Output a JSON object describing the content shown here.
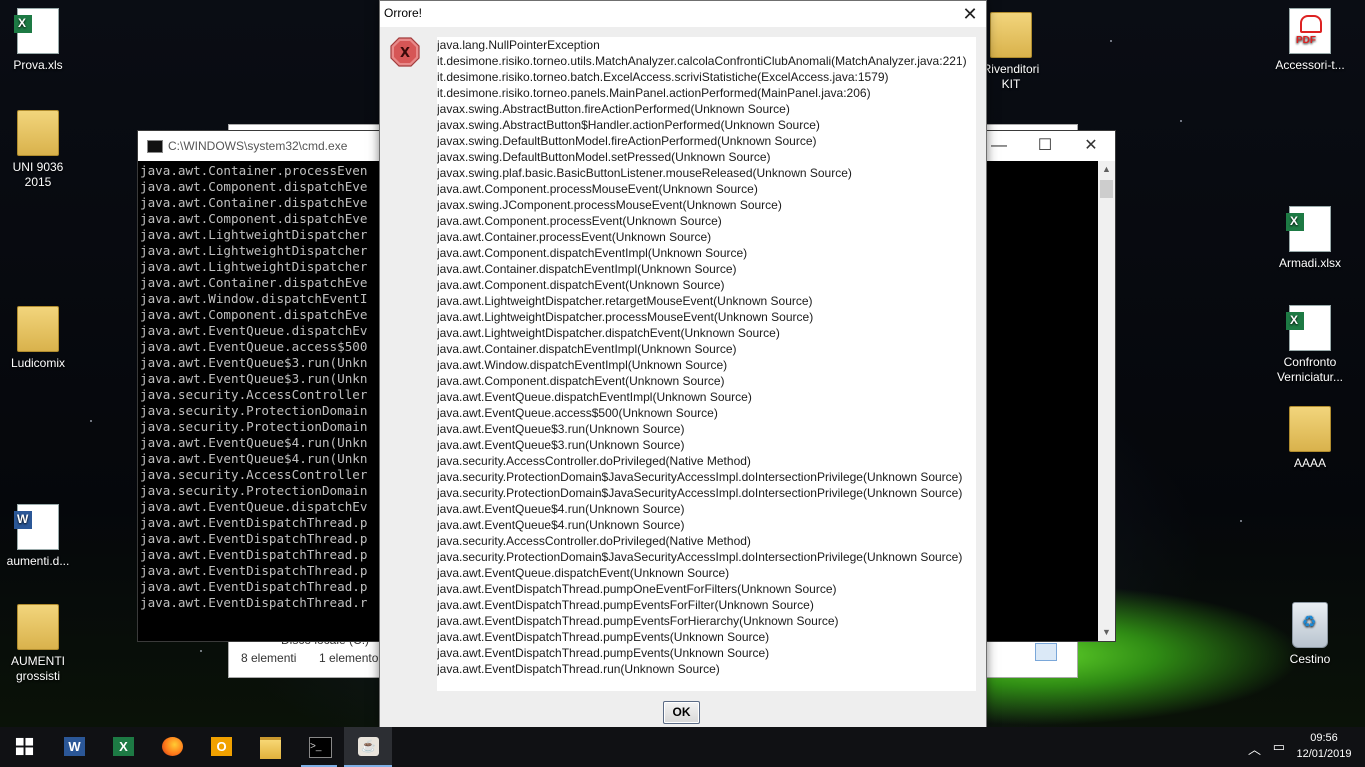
{
  "desktop": {
    "icons_left": [
      {
        "label": "Prova.xls",
        "type": "excel"
      },
      {
        "label": "UNI 9036\n2015",
        "type": "folder"
      },
      {
        "label": "Ludicomix",
        "type": "folder"
      },
      {
        "label": "aumenti.d...",
        "type": "word"
      },
      {
        "label": "AUMENTI\ngrossisti",
        "type": "folder"
      }
    ],
    "icons_right": [
      {
        "label": "Rivenditori\nKIT",
        "type": "folder"
      },
      {
        "label": "Accessori-t...",
        "type": "pdf"
      },
      {
        "label": "Armadi.xlsx",
        "type": "excel"
      },
      {
        "label": "Confronto\nVerniciatur...",
        "type": "excel"
      },
      {
        "label": "AAAA",
        "type": "folder"
      },
      {
        "label": "Cestino",
        "type": "recycle-bin"
      }
    ]
  },
  "cmd_window": {
    "title": "C:\\WINDOWS\\system32\\cmd.exe",
    "lines": [
      "java.awt.Container.processEven",
      "java.awt.Component.dispatchEve",
      "java.awt.Container.dispatchEve",
      "java.awt.Component.dispatchEve",
      "java.awt.LightweightDispatcher",
      "java.awt.LightweightDispatcher",
      "java.awt.LightweightDispatcher",
      "java.awt.Container.dispatchEve",
      "java.awt.Window.dispatchEventI",
      "java.awt.Component.dispatchEve",
      "java.awt.EventQueue.dispatchEv",
      "java.awt.EventQueue.access$500",
      "java.awt.EventQueue$3.run(Unkn",
      "java.awt.EventQueue$3.run(Unkn",
      "java.security.AccessController",
      "java.security.ProtectionDomain",
      "java.security.ProtectionDomain",
      "java.awt.EventQueue$4.run(Unkn",
      "java.awt.EventQueue$4.run(Unkn",
      "java.security.AccessController",
      "java.security.ProtectionDomain",
      "java.awt.EventQueue.dispatchEv",
      "java.awt.EventDispatchThread.p",
      "java.awt.EventDispatchThread.p",
      "java.awt.EventDispatchThread.p",
      "java.awt.EventDispatchThread.p",
      "java.awt.EventDispatchThread.p",
      "java.awt.EventDispatchThread.r"
    ]
  },
  "explorer_window": {
    "drive_label": "Disco locale (C:)",
    "item_count": "8 elementi",
    "selected_count": "1 elemento"
  },
  "dialog": {
    "title": "Orrore!",
    "icon": "error-x-icon",
    "ok_label": "OK",
    "lines": [
      "java.lang.NullPointerException",
      "it.desimone.risiko.torneo.utils.MatchAnalyzer.calcolaConfrontiClubAnomali(MatchAnalyzer.java:221)",
      "it.desimone.risiko.torneo.batch.ExcelAccess.scriviStatistiche(ExcelAccess.java:1579)",
      "it.desimone.risiko.torneo.panels.MainPanel.actionPerformed(MainPanel.java:206)",
      "javax.swing.AbstractButton.fireActionPerformed(Unknown Source)",
      "javax.swing.AbstractButton$Handler.actionPerformed(Unknown Source)",
      "javax.swing.DefaultButtonModel.fireActionPerformed(Unknown Source)",
      "javax.swing.DefaultButtonModel.setPressed(Unknown Source)",
      "javax.swing.plaf.basic.BasicButtonListener.mouseReleased(Unknown Source)",
      "java.awt.Component.processMouseEvent(Unknown Source)",
      "javax.swing.JComponent.processMouseEvent(Unknown Source)",
      "java.awt.Component.processEvent(Unknown Source)",
      "java.awt.Container.processEvent(Unknown Source)",
      "java.awt.Component.dispatchEventImpl(Unknown Source)",
      "java.awt.Container.dispatchEventImpl(Unknown Source)",
      "java.awt.Component.dispatchEvent(Unknown Source)",
      "java.awt.LightweightDispatcher.retargetMouseEvent(Unknown Source)",
      "java.awt.LightweightDispatcher.processMouseEvent(Unknown Source)",
      "java.awt.LightweightDispatcher.dispatchEvent(Unknown Source)",
      "java.awt.Container.dispatchEventImpl(Unknown Source)",
      "java.awt.Window.dispatchEventImpl(Unknown Source)",
      "java.awt.Component.dispatchEvent(Unknown Source)",
      "java.awt.EventQueue.dispatchEventImpl(Unknown Source)",
      "java.awt.EventQueue.access$500(Unknown Source)",
      "java.awt.EventQueue$3.run(Unknown Source)",
      "java.awt.EventQueue$3.run(Unknown Source)",
      "java.security.AccessController.doPrivileged(Native Method)",
      "java.security.ProtectionDomain$JavaSecurityAccessImpl.doIntersectionPrivilege(Unknown Source)",
      "java.security.ProtectionDomain$JavaSecurityAccessImpl.doIntersectionPrivilege(Unknown Source)",
      "java.awt.EventQueue$4.run(Unknown Source)",
      "java.awt.EventQueue$4.run(Unknown Source)",
      "java.security.AccessController.doPrivileged(Native Method)",
      "java.security.ProtectionDomain$JavaSecurityAccessImpl.doIntersectionPrivilege(Unknown Source)",
      "java.awt.EventQueue.dispatchEvent(Unknown Source)",
      "java.awt.EventDispatchThread.pumpOneEventForFilters(Unknown Source)",
      "java.awt.EventDispatchThread.pumpEventsForFilter(Unknown Source)",
      "java.awt.EventDispatchThread.pumpEventsForHierarchy(Unknown Source)",
      "java.awt.EventDispatchThread.pumpEvents(Unknown Source)",
      "java.awt.EventDispatchThread.pumpEvents(Unknown Source)",
      "java.awt.EventDispatchThread.run(Unknown Source)"
    ]
  },
  "taskbar": {
    "apps": [
      "start-button",
      "word",
      "excel",
      "firefox",
      "outlook",
      "file-explorer",
      "cmd",
      "java"
    ],
    "time": "09:56",
    "date": "12/01/2019"
  }
}
